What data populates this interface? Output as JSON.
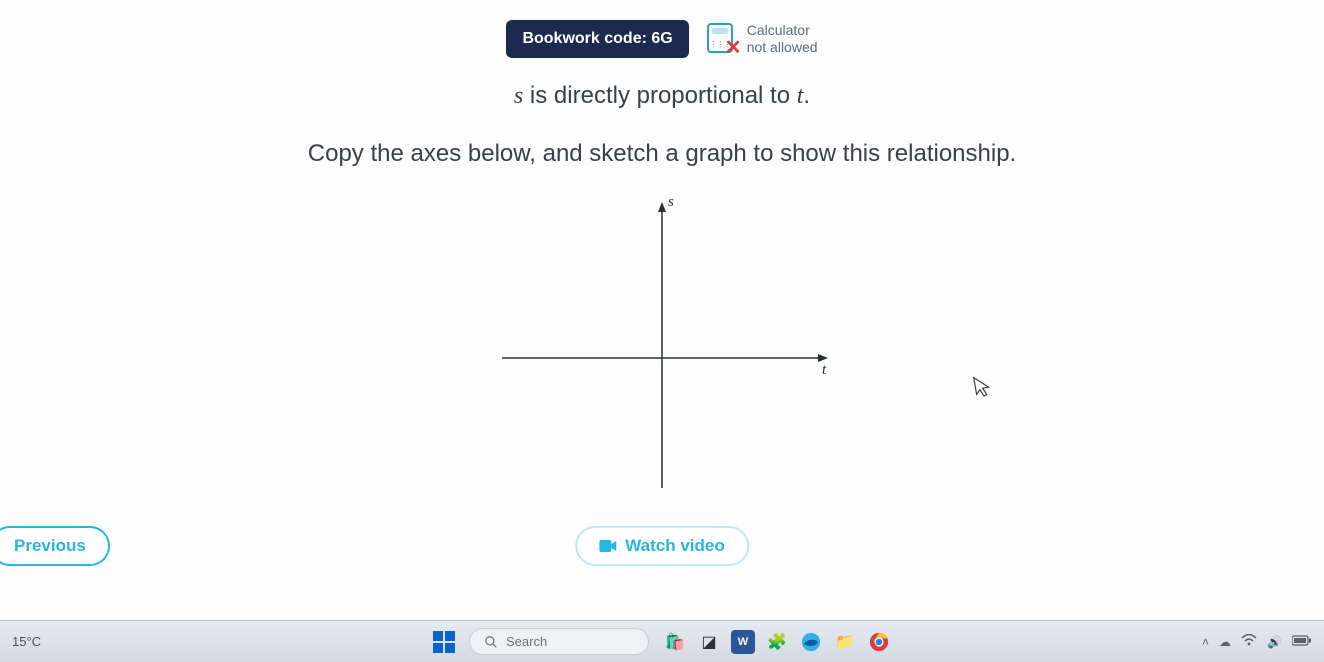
{
  "header": {
    "badge": "Bookwork code: 6G",
    "calculator_line1": "Calculator",
    "calculator_line2": "not allowed"
  },
  "question": {
    "line1_pre": "s",
    "line1_mid": " is directly proportional to ",
    "line1_post": "t",
    "line1_end": ".",
    "line2": "Copy the axes below, and sketch a graph to show this relationship."
  },
  "chart_data": {
    "type": "axes-only",
    "xlabel": "t",
    "ylabel": "s",
    "series": []
  },
  "buttons": {
    "previous": "Previous",
    "watch_video": "Watch video"
  },
  "taskbar": {
    "weather": "15°C",
    "search_placeholder": "Search"
  }
}
